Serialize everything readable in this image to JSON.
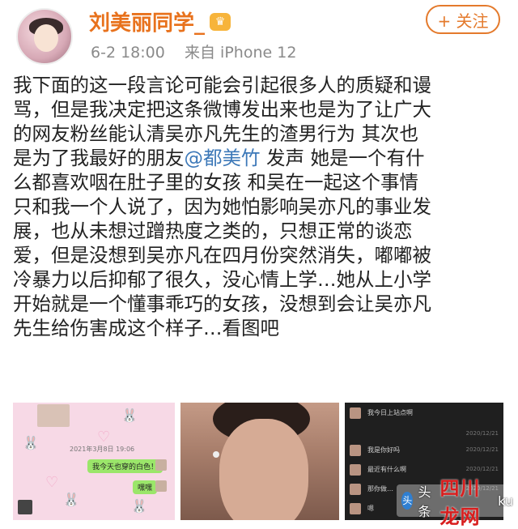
{
  "post": {
    "username": "刘美丽同学_",
    "vip_badge": "♛",
    "date": "6-2 18:00",
    "source": "来自 iPhone 12",
    "follow_label": "+ 关注",
    "content_lines": [
      "我下面的这一段言论可能会引起很多人的质疑和谩",
      "骂，但是我决定把这条微博发出来也是为了让广大",
      "的网友粉丝能认清吴亦凡先生的渣男行为  其次也",
      "是为了我最好的朋友",
      "么都喜欢咽在肚子里的女孩  和吴在一起这个事情",
      "只和我一个人说了，因为她怕影响吴亦凡的事业发",
      "展，也从未想过蹭热度之类的，只想正常的谈恋",
      "爱，但是没想到吴亦凡在四月份突然消失，嘟嘟被",
      "冷暴力以后抑郁了很久，没心情上学…她从上小学",
      "开始就是一个懂事乖巧的女孩，没想到会让吴亦凡",
      "先生给伤害成这个样子…看图吧"
    ],
    "mention": "@都美竹",
    "line4_tail": " 发声  她是一个有什"
  },
  "images": {
    "chat1": {
      "date": "2021年3月8日 19:06",
      "msg_green": "我今天也穿的白色！",
      "msg_green2": "嘿嘿"
    },
    "chat3": {
      "rows": [
        {
          "text": "我今日上站点啊",
          "time": "2020/12/21"
        },
        {
          "text": "我是你好吗",
          "time": "2020/12/21"
        },
        {
          "text": "最近有什么啊",
          "time": "2020/12/21"
        },
        {
          "text": "那你做…",
          "time": "2020/12/21"
        },
        {
          "text": "嗯",
          "time": "2020/12/21"
        }
      ]
    }
  },
  "watermark": {
    "small": "头条",
    "brand": "四川龙网",
    "suffix": "ku"
  }
}
